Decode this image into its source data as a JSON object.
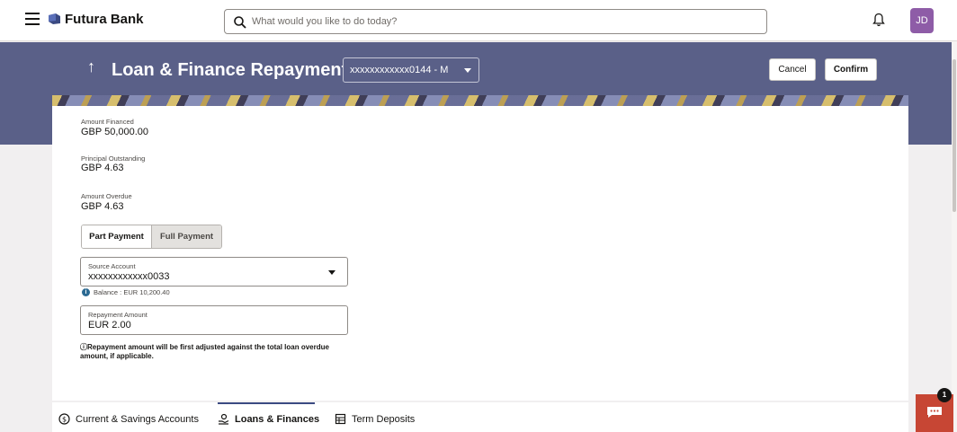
{
  "header": {
    "brand": "Futura Bank",
    "search_placeholder": "What would you like to do today?",
    "avatar_initials": "JD"
  },
  "page": {
    "title": "Loan & Finance Repayments",
    "account_selected": "xxxxxxxxxxxx0144 - M",
    "cancel_label": "Cancel",
    "confirm_label": "Confirm"
  },
  "loan": {
    "amount_financed_label": "Amount Financed",
    "amount_financed_value": "GBP 50,000.00",
    "principal_outstanding_label": "Principal Outstanding",
    "principal_outstanding_value": "GBP 4.63",
    "amount_overdue_label": "Amount Overdue",
    "amount_overdue_value": "GBP 4.63"
  },
  "payment_type": {
    "part_label": "Part Payment",
    "full_label": "Full Payment",
    "selected": "Part Payment"
  },
  "source_account": {
    "label": "Source Account",
    "value": "xxxxxxxxxxxx0033",
    "balance": "Balance : EUR 10,200.40"
  },
  "repayment": {
    "label": "Repayment Amount",
    "value": "EUR 2.00",
    "note": "Repayment amount will be first adjusted against the total loan overdue amount, if applicable."
  },
  "tabs": [
    {
      "label": "Current & Savings Accounts",
      "icon": "currency-circle-icon"
    },
    {
      "label": "Loans & Finances",
      "icon": "loan-hand-icon",
      "active": true
    },
    {
      "label": "Term Deposits",
      "icon": "deposit-ledger-icon"
    }
  ],
  "chat": {
    "badge_count": "1"
  },
  "colors": {
    "banner": "#5a6088",
    "accent": "#3b4a82",
    "chat": "#c74634",
    "avatar": "#8e5ca7"
  }
}
